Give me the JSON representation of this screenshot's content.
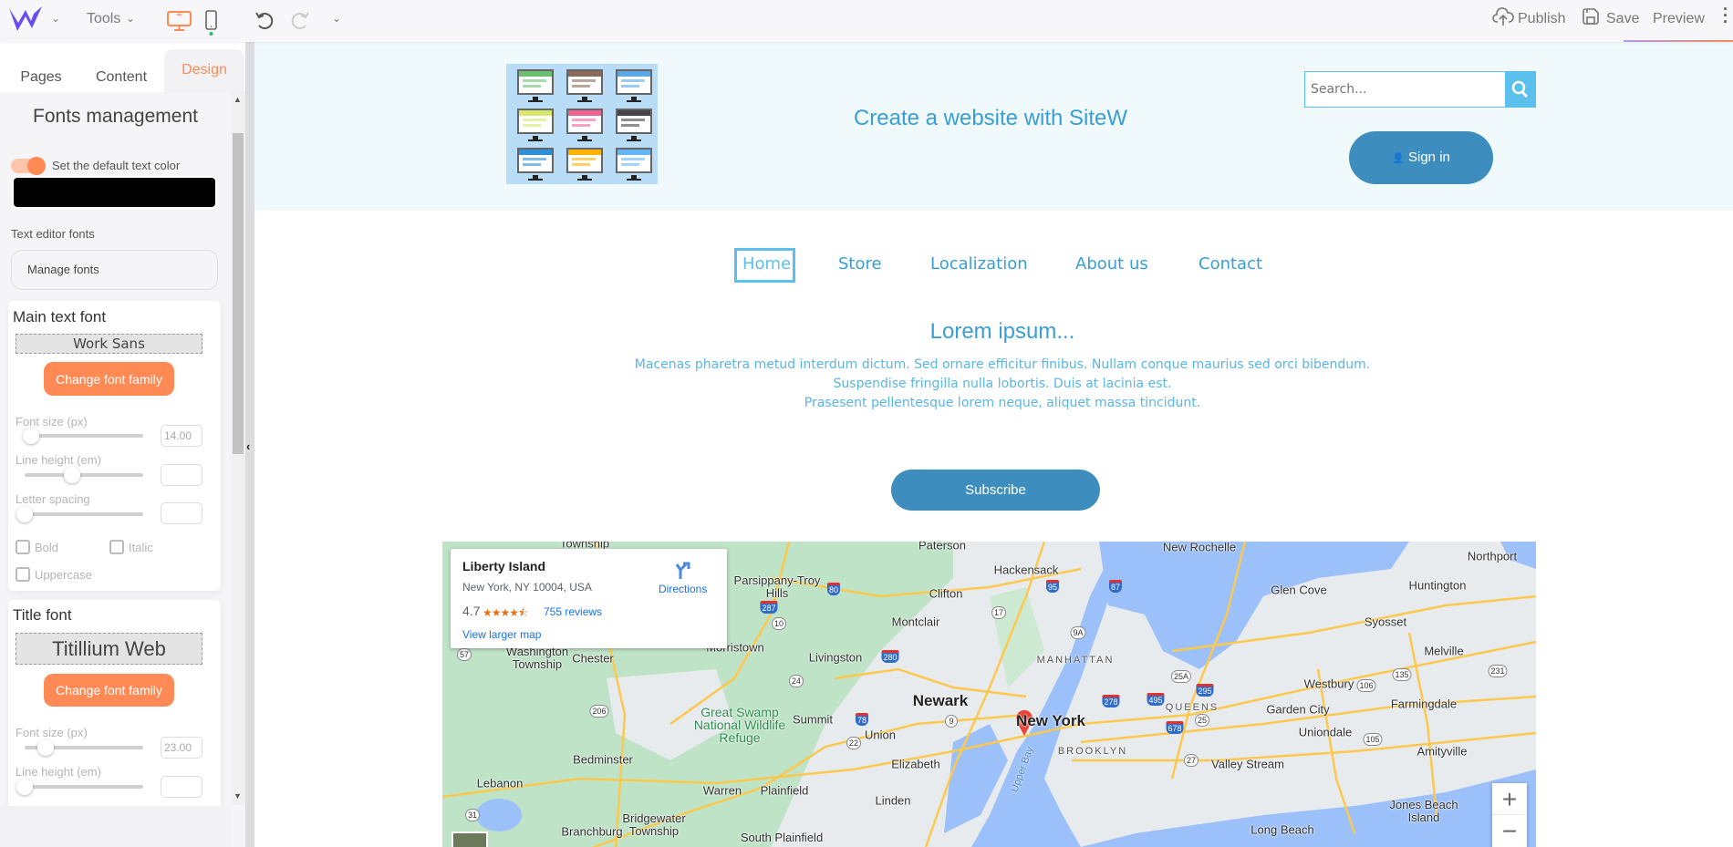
{
  "topbar": {
    "tools_label": "Tools",
    "publish_label": "Publish",
    "save_label": "Save",
    "preview_label": "Preview",
    "accent": "#ff8a56",
    "logo_color": "#6a4cf0"
  },
  "sidebar": {
    "tabs": [
      {
        "label": "Pages"
      },
      {
        "label": "Content"
      },
      {
        "label": "Design",
        "active": true
      }
    ],
    "title": "Fonts management",
    "default_color_toggle": {
      "label": "Set the default text color",
      "on": true,
      "color": "#000000"
    },
    "text_editor_fonts_label": "Text editor fonts",
    "manage_fonts_label": "Manage fonts",
    "main_font": {
      "heading": "Main text font",
      "family": "Work Sans",
      "change_label": "Change font family",
      "font_size_label": "Font size (px)",
      "font_size_value": "14.00",
      "font_size_level": 0.05,
      "line_height_label": "Line height (em)",
      "line_height_level": 0.4,
      "letter_spacing_label": "Letter spacing",
      "letter_spacing_level": 0,
      "bold_label": "Bold",
      "italic_label": "Italic",
      "uppercase_label": "Uppercase"
    },
    "title_font": {
      "heading": "Title font",
      "family": "Titillium Web",
      "change_label": "Change font family",
      "font_size_label": "Font size (px)",
      "font_size_value": "23.00",
      "font_size_level": 0.18,
      "line_height_label": "Line height (em)",
      "line_height_level": 0
    }
  },
  "site": {
    "title": "Create a website with SiteW",
    "search_placeholder": "Search...",
    "sign_in_label": "Sign in",
    "nav": [
      {
        "label": "Home",
        "active": true
      },
      {
        "label": "Store"
      },
      {
        "label": "Localization"
      },
      {
        "label": "About us"
      },
      {
        "label": "Contact"
      }
    ],
    "heading": "Lorem ipsum...",
    "paragraph": [
      "Macenas pharetra metud interdum dictum. Sed ornare efficitur finibus. Nullam conque maurius sed orci bibendum.",
      "Suspendise fringilla nulla lobortis. Duis at lacinia est.",
      "Prasesent pellentesque lorem neque, aliquet massa tincidunt."
    ],
    "subscribe_label": "Subscribe",
    "primary_color": "#3d8ebf"
  },
  "map": {
    "place_name": "Liberty Island",
    "address": "New York, NY 10004, USA",
    "rating": "4.7",
    "stars": 4.7,
    "reviews_label": "755 reviews",
    "directions_label": "Directions",
    "larger_map_label": "View larger map",
    "zoom_in": "+",
    "zoom_out": "−",
    "labels": [
      "Washington Township",
      "Chester",
      "Morristown",
      "Parsippany-Troy Hills",
      "Clifton",
      "Montclair",
      "Livingston",
      "Newark",
      "Great Swamp National Wildlife Refuge",
      "Summit",
      "Union",
      "Elizabeth",
      "Bedminster",
      "Lebanon",
      "Warren",
      "Plainfield",
      "Linden",
      "Bridgewater Township",
      "Branchburg",
      "South Plainfield",
      "New Rochelle",
      "Hackensack",
      "Glen Cove",
      "Northport",
      "Huntington",
      "Syosset",
      "Melville",
      "MANHATTAN",
      "Westbury",
      "QUEENS",
      "Garden City",
      "Farmingdale",
      "New York",
      "Uniondale",
      "BROOKLYN",
      "Amityville",
      "Valley Stream",
      "Jones Beach Island",
      "Long Beach",
      "Upper Bay",
      "Paterson",
      "Township"
    ],
    "shields": [
      "287",
      "80",
      "10",
      "280",
      "24",
      "206",
      "78",
      "22",
      "9",
      "95",
      "87",
      "17",
      "9A",
      "278",
      "495",
      "295",
      "678",
      "25A",
      "25",
      "106",
      "135",
      "105",
      "27",
      "231",
      "57",
      "31"
    ]
  }
}
